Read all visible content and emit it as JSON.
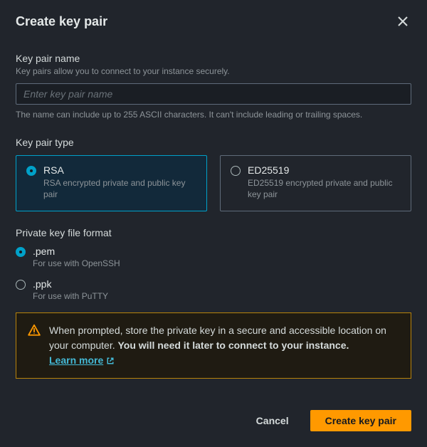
{
  "header": {
    "title": "Create key pair"
  },
  "name_section": {
    "label": "Key pair name",
    "helper": "Key pairs allow you to connect to your instance securely.",
    "placeholder": "Enter key pair name",
    "value": "",
    "constraint": "The name can include up to 255 ASCII characters. It can't include leading or trailing spaces."
  },
  "type_section": {
    "label": "Key pair type",
    "options": [
      {
        "title": "RSA",
        "desc": "RSA encrypted private and public key pair",
        "selected": true
      },
      {
        "title": "ED25519",
        "desc": "ED25519 encrypted private and public key pair",
        "selected": false
      }
    ]
  },
  "format_section": {
    "label": "Private key file format",
    "options": [
      {
        "title": ".pem",
        "desc": "For use with OpenSSH",
        "selected": true
      },
      {
        "title": ".ppk",
        "desc": "For use with PuTTY",
        "selected": false
      }
    ]
  },
  "alert": {
    "text_before": "When prompted, store the private key in a secure and accessible location on your computer. ",
    "text_bold": "You will need it later to connect to your instance.",
    "link_label": "Learn more"
  },
  "footer": {
    "cancel": "Cancel",
    "submit": "Create key pair"
  }
}
